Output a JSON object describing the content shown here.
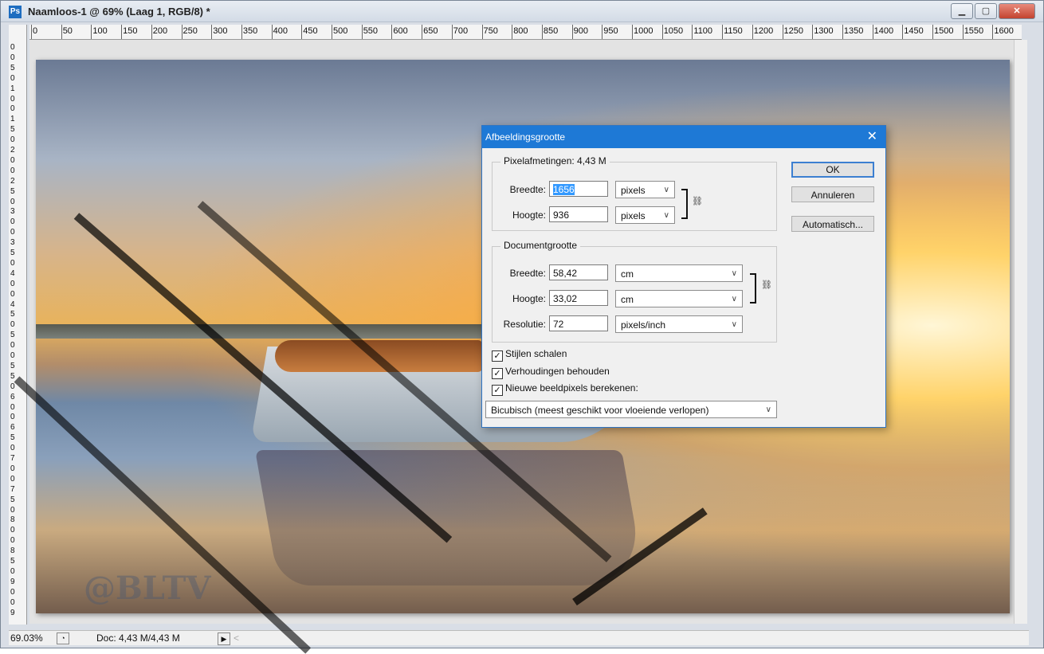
{
  "window": {
    "app_icon": "Ps",
    "title": "Naamloos-1 @ 69% (Laag 1, RGB/8) *",
    "buttons": [
      "minimize-icon",
      "maximize-icon",
      "close-icon"
    ]
  },
  "ruler": {
    "top_labels": [
      "0",
      "50",
      "100",
      "150",
      "200",
      "250",
      "300",
      "350",
      "400",
      "450",
      "500",
      "550",
      "600",
      "650",
      "700",
      "750",
      "800",
      "850",
      "900",
      "950",
      "1000",
      "1050",
      "1100",
      "1150",
      "1200",
      "1250",
      "1300",
      "1350",
      "1400",
      "1450",
      "1500",
      "1550",
      "1600",
      "16"
    ],
    "left_digits": [
      "0",
      "0",
      "5",
      "0",
      "1",
      "0",
      "0",
      "1",
      "5",
      "0",
      "2",
      "0",
      "0",
      "2",
      "5",
      "0",
      "3",
      "0",
      "0",
      "3",
      "5",
      "0",
      "4",
      "0",
      "0",
      "4",
      "5",
      "0",
      "5",
      "0",
      "0",
      "5",
      "5",
      "0",
      "6",
      "0",
      "0",
      "6",
      "5",
      "0",
      "7",
      "0",
      "0",
      "7",
      "5",
      "0",
      "8",
      "0",
      "0",
      "8",
      "5",
      "0",
      "9",
      "0",
      "0",
      "9"
    ]
  },
  "canvas": {
    "watermark": "@BLTV"
  },
  "status": {
    "zoom": "69.03%",
    "doc": "Doc: 4,43 M/4,43 M",
    "arrow": "▶",
    "scroll_left": "<"
  },
  "dialog": {
    "title": "Afbeeldingsgrootte",
    "pixel_group": {
      "legend": "Pixelafmetingen:  4,43 M",
      "width_label": "Breedte:",
      "width_value": "1656",
      "width_unit": "pixels",
      "height_label": "Hoogte:",
      "height_value": "936",
      "height_unit": "pixels"
    },
    "doc_group": {
      "legend": "Documentgrootte",
      "width_label": "Breedte:",
      "width_value": "58,42",
      "width_unit": "cm",
      "height_label": "Hoogte:",
      "height_value": "33,02",
      "height_unit": "cm",
      "res_label": "Resolutie:",
      "res_value": "72",
      "res_unit": "pixels/inch"
    },
    "buttons": {
      "ok": "OK",
      "cancel": "Annuleren",
      "auto": "Automatisch..."
    },
    "checks": {
      "styles": "Stijlen schalen",
      "proportions": "Verhoudingen behouden",
      "resample": "Nieuwe beeldpixels berekenen:"
    },
    "resample_method": "Bicubisch (meest geschikt voor vloeiende verlopen)"
  }
}
